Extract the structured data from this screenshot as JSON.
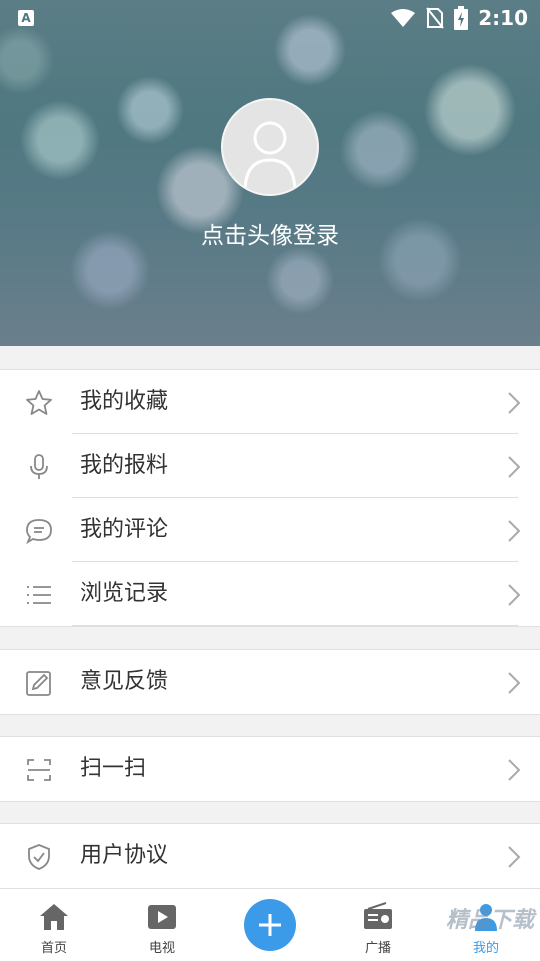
{
  "status_bar": {
    "time": "2:10"
  },
  "profile": {
    "login_text": "点击头像登录"
  },
  "menu": {
    "group1": [
      {
        "label": "我的收藏",
        "icon": "star-icon"
      },
      {
        "label": "我的报料",
        "icon": "microphone-icon"
      },
      {
        "label": "我的评论",
        "icon": "comment-icon"
      },
      {
        "label": "浏览记录",
        "icon": "list-icon"
      }
    ],
    "group2": [
      {
        "label": "意见反馈",
        "icon": "edit-icon"
      }
    ],
    "group3": [
      {
        "label": "扫一扫",
        "icon": "scan-icon"
      }
    ],
    "group4": [
      {
        "label": "用户协议",
        "icon": "shield-icon"
      }
    ]
  },
  "bottom_nav": [
    {
      "label": "首页",
      "icon": "home-icon"
    },
    {
      "label": "电视",
      "icon": "tv-play-icon"
    },
    {
      "label": "",
      "icon": "plus-icon"
    },
    {
      "label": "广播",
      "icon": "radio-icon"
    },
    {
      "label": "我的",
      "icon": "person-icon"
    }
  ],
  "watermark": "精品下载",
  "colors": {
    "accent": "#3b9be8",
    "header_tint": "#4f7880"
  }
}
